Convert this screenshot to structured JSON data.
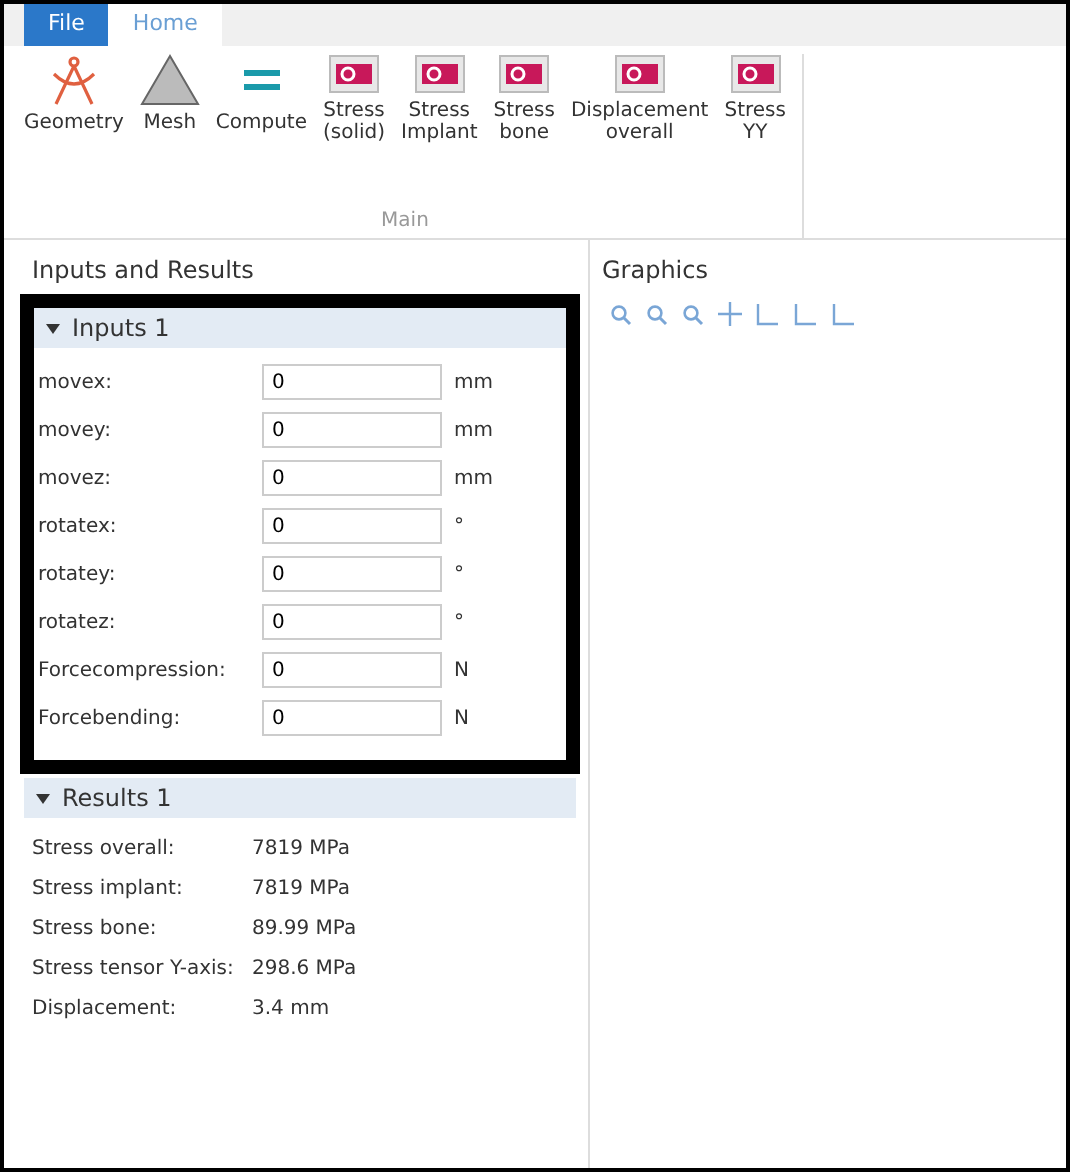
{
  "ribbon": {
    "tabs": [
      {
        "label": "File",
        "kind": "file",
        "selected": false
      },
      {
        "label": "Home",
        "kind": "tab",
        "selected": true
      }
    ],
    "buttons": [
      {
        "label": "Geometry",
        "kind": "geometry"
      },
      {
        "label": "Mesh",
        "kind": "mesh"
      },
      {
        "label": "Compute",
        "kind": "compute"
      },
      {
        "label": "Stress\n(solid)",
        "kind": "plot"
      },
      {
        "label": "Stress\nImplant",
        "kind": "plot"
      },
      {
        "label": "Stress\nbone",
        "kind": "plot"
      },
      {
        "label": "Displacement\noverall",
        "kind": "plot"
      },
      {
        "label": "Stress\nYY",
        "kind": "plot"
      }
    ],
    "group_label": "Main"
  },
  "left_panel": {
    "title": "Inputs and Results",
    "inputs": {
      "title": "Inputs 1",
      "expanded": true,
      "fields": [
        {
          "label": "movex:",
          "value": "0",
          "unit": "mm"
        },
        {
          "label": "movey:",
          "value": "0",
          "unit": "mm"
        },
        {
          "label": "movez:",
          "value": "0",
          "unit": "mm"
        },
        {
          "label": "rotatex:",
          "value": "0",
          "unit": "°"
        },
        {
          "label": "rotatey:",
          "value": "0",
          "unit": "°"
        },
        {
          "label": "rotatez:",
          "value": "0",
          "unit": "°"
        },
        {
          "label": "Forcecompression:",
          "value": "0",
          "unit": "N"
        },
        {
          "label": "Forcebending:",
          "value": "0",
          "unit": "N"
        }
      ]
    },
    "results": {
      "title": "Results 1",
      "expanded": true,
      "rows": [
        {
          "label": "Stress overall:",
          "value": "7819 MPa"
        },
        {
          "label": "Stress implant:",
          "value": "7819 MPa"
        },
        {
          "label": "Stress bone:",
          "value": "89.99 MPa"
        },
        {
          "label": "Stress tensor Y-axis:",
          "value": "298.6 MPa"
        },
        {
          "label": "Displacement:",
          "value": "3.4 mm"
        }
      ]
    }
  },
  "graphics": {
    "title": "Graphics"
  }
}
